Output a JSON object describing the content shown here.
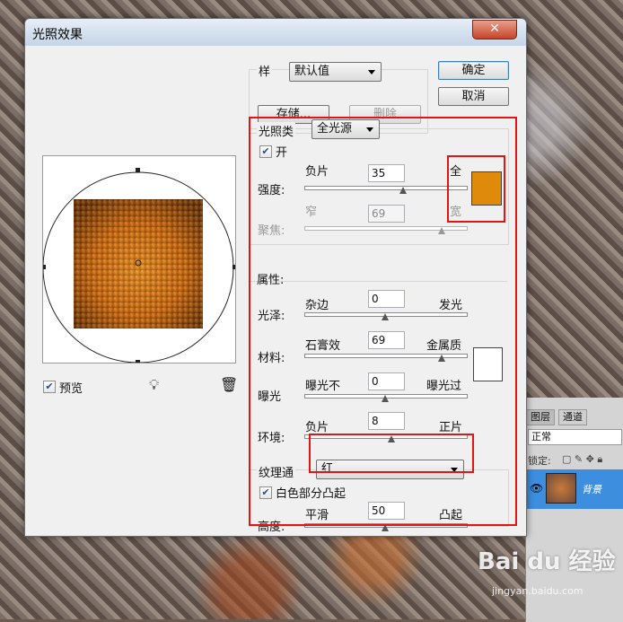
{
  "dialog": {
    "title": "光照效果",
    "close_label": "✕",
    "style_label": "样",
    "style_value": "默认值",
    "save_button": "存储...",
    "delete_button": "删除",
    "ok_button": "确定",
    "cancel_button": "取消",
    "preview_label": "预览",
    "preview_checked": true
  },
  "light_type": {
    "label": "光照类",
    "value": "全光源",
    "on_label": "开",
    "on_checked": true,
    "intensity": {
      "label": "强度:",
      "min_label": "负片",
      "max_label": "全",
      "value": "35",
      "fraction": 0.61
    },
    "focus": {
      "label": "聚焦:",
      "min_label": "窄",
      "max_label": "宽",
      "value": "69",
      "fraction": 0.85
    },
    "color": "#e08a0c"
  },
  "properties": {
    "header": "属性:",
    "gloss": {
      "label": "光泽:",
      "min_label": "杂边",
      "max_label": "发光",
      "value": "0",
      "fraction": 0.5
    },
    "material": {
      "label": "材料:",
      "min_label": "石膏效",
      "max_label": "金属质",
      "value": "69",
      "fraction": 0.85
    },
    "exposure": {
      "label": "曝光",
      "min_label": "曝光不",
      "max_label": "曝光过",
      "value": "0",
      "fraction": 0.5
    },
    "ambience": {
      "label": "环境:",
      "min_label": "负片",
      "max_label": "正片",
      "value": "8",
      "fraction": 0.54
    },
    "color": "#ffffff"
  },
  "texture": {
    "label": "纹理通",
    "channel": "红",
    "white_high_label": "白色部分凸起",
    "white_high_checked": true,
    "height": {
      "label": "高度:",
      "min_label": "平滑",
      "max_label": "凸起",
      "value": "50",
      "fraction": 0.5
    }
  },
  "layers_panel": {
    "tab_layers": "图层",
    "tab_channels": "通道",
    "blend_mode": "正常",
    "lock_label": "锁定:",
    "layer_name": "背景"
  },
  "watermark": {
    "brand": "Bai du 经验",
    "url": "jingyan.baidu.com"
  },
  "highlight_color": "#e41414"
}
